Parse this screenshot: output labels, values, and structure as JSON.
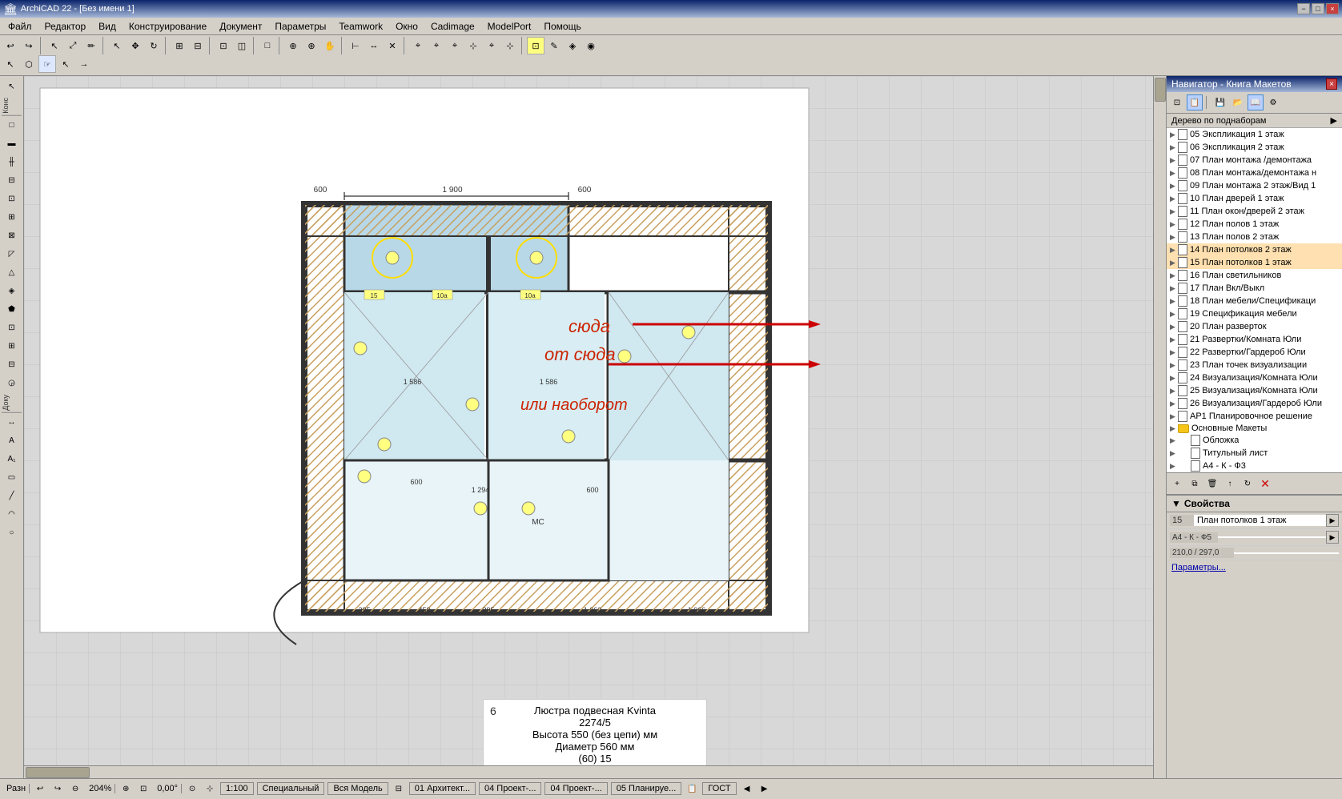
{
  "title_bar": {
    "title": "ArchiCAD 22 - [Без имени 1]",
    "min_label": "−",
    "max_label": "□",
    "close_label": "×"
  },
  "menu": {
    "items": [
      "Файл",
      "Редактор",
      "Вид",
      "Конструирование",
      "Документ",
      "Параметры",
      "Teamwork",
      "Окно",
      "Cadimage",
      "ModelPort",
      "Помощь"
    ]
  },
  "navigator": {
    "title": "Навигатор - Книга Макетов",
    "tree_header": "Дерево по поднаборам",
    "close_label": "×",
    "items": [
      {
        "id": "05",
        "label": "05 Экспликация 1 этаж",
        "type": "page",
        "indent": 0
      },
      {
        "id": "06",
        "label": "06 Экспликация 2 этаж",
        "type": "page",
        "indent": 0
      },
      {
        "id": "07",
        "label": "07 План монтажа /демонтажа",
        "type": "page",
        "indent": 0
      },
      {
        "id": "08",
        "label": "08 План монтажа/демонтажа н",
        "type": "page",
        "indent": 0
      },
      {
        "id": "09",
        "label": "09 План монтажа 2 этаж/Вид 1",
        "type": "page",
        "indent": 0
      },
      {
        "id": "10",
        "label": "10 План дверей 1 этаж",
        "type": "page",
        "indent": 0
      },
      {
        "id": "11",
        "label": "11 План окон/дверей 2 этаж",
        "type": "page",
        "indent": 0
      },
      {
        "id": "12",
        "label": "12 План полов 1 этаж",
        "type": "page",
        "indent": 0
      },
      {
        "id": "13",
        "label": "13 План полов 2 этаж",
        "type": "page",
        "indent": 0
      },
      {
        "id": "14",
        "label": "14 План потолков 2 этаж",
        "type": "page",
        "indent": 0,
        "highlighted": true
      },
      {
        "id": "15",
        "label": "15 План потолков 1 этаж",
        "type": "page",
        "indent": 0,
        "highlighted": true
      },
      {
        "id": "16",
        "label": "16 План светильников",
        "type": "page",
        "indent": 0
      },
      {
        "id": "17",
        "label": "17 План Вкл/Выкл",
        "type": "page",
        "indent": 0
      },
      {
        "id": "18",
        "label": "18 План мебели/Спецификаци",
        "type": "page",
        "indent": 0
      },
      {
        "id": "19",
        "label": "19 Спецификация мебели",
        "type": "page",
        "indent": 0
      },
      {
        "id": "20",
        "label": "20 План разверток",
        "type": "page",
        "indent": 0
      },
      {
        "id": "21",
        "label": "21 Развертки/Комната Юли",
        "type": "page",
        "indent": 0
      },
      {
        "id": "22",
        "label": "22 Развертки/Гардероб Юли",
        "type": "page",
        "indent": 0
      },
      {
        "id": "23",
        "label": "23 План точек визуализации",
        "type": "page",
        "indent": 0
      },
      {
        "id": "24",
        "label": "24 Визуализация/Комната Юли",
        "type": "page",
        "indent": 0
      },
      {
        "id": "25",
        "label": "25 Визуализация/Комната Юли",
        "type": "page",
        "indent": 0
      },
      {
        "id": "26",
        "label": "26 Визуализация/Гардероб Юли",
        "type": "page",
        "indent": 0
      },
      {
        "id": "AP1",
        "label": "АР1 Планировочное решение",
        "type": "page",
        "indent": 0
      },
      {
        "id": "osnov",
        "label": "Основные Макеты",
        "type": "folder",
        "indent": 0
      },
      {
        "id": "obl",
        "label": "Обложка",
        "type": "page",
        "indent": 1
      },
      {
        "id": "tit",
        "label": "Титульный лист",
        "type": "page",
        "indent": 1
      },
      {
        "id": "a4kf3",
        "label": "А4 - К - Ф3",
        "type": "page",
        "indent": 1
      }
    ]
  },
  "properties": {
    "header": "Свойства",
    "rows": [
      {
        "key": "15",
        "value": "План потолков 1 этаж"
      },
      {
        "key": "А4 - К - Ф5",
        "value": ""
      },
      {
        "key": "210,0 / 297,0",
        "value": ""
      }
    ],
    "footer": "Параметры..."
  },
  "status_bar": {
    "mode": "Разн",
    "zoom": "204%",
    "angle": "0,00°",
    "scale_label": "1:100",
    "layer": "Специальный",
    "model": "Вся Модель",
    "breadcrumbs": [
      "01 Архитект...",
      "04 Проект-...",
      "04 Проект-...",
      "05 Планируе..."
    ],
    "standard": "ГОСТ"
  },
  "info_panel": {
    "number": "6",
    "line1": "Люстра подвесная Kvinta",
    "line2": "2274/5",
    "line3": "Высота 550 (без цепи) мм",
    "line4": "Диаметр 560 мм",
    "line5": "(60) 15"
  },
  "annotations": {
    "syuda": "сюда",
    "ot_syuda": "от сюда",
    "ili_naoborot": "или наоборот"
  },
  "left_toolbar": {
    "cons_label": "Конс",
    "doku_label": "Доку",
    "icons": [
      "▲",
      "↖",
      "□",
      "◇",
      "△",
      "⌐",
      "⊢",
      "⊏",
      "◫",
      "✎",
      "⋯",
      "∿",
      "⊡",
      "⊞",
      "⊟",
      "◎",
      "A",
      "A1",
      "▭",
      "○"
    ]
  }
}
